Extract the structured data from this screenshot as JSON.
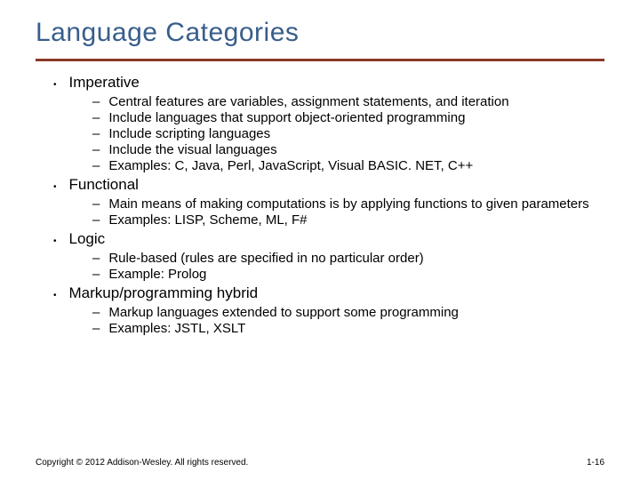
{
  "title": "Language Categories",
  "categories": [
    {
      "name": "Imperative",
      "subs": [
        "Central features are variables, assignment statements, and iteration",
        "Include languages that support object-oriented programming",
        "Include scripting languages",
        "Include the visual languages",
        "Examples: C, Java, Perl, JavaScript, Visual BASIC. NET, C++"
      ]
    },
    {
      "name": "Functional",
      "subs": [
        "Main means of making computations is by applying functions to given parameters",
        "Examples: LISP, Scheme, ML, F#"
      ]
    },
    {
      "name": "Logic",
      "subs": [
        "Rule-based (rules are specified in no particular order)",
        "Example: Prolog"
      ]
    },
    {
      "name": "Markup/programming hybrid",
      "subs": [
        "Markup languages extended to support some programming",
        "Examples: JSTL, XSLT"
      ]
    }
  ],
  "footer": {
    "copyright": "Copyright © 2012 Addison-Wesley. All rights reserved.",
    "page": "1-16"
  }
}
